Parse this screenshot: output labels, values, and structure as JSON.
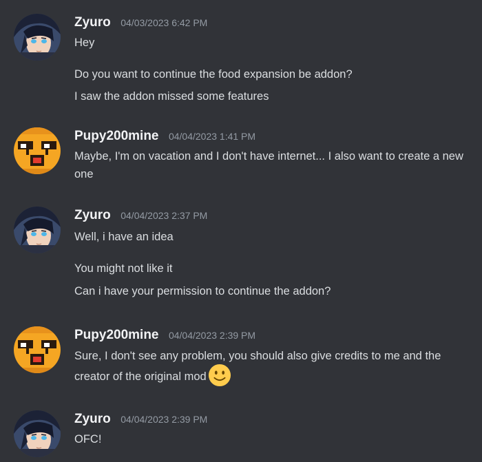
{
  "messages": [
    {
      "username": "Zyuro",
      "avatar": "anime-character-avatar",
      "timestamp": "04/03/2023 6:42 PM",
      "lines": [
        "Hey",
        "Do you want to continue the food expansion be addon?",
        "I saw the addon missed some features"
      ]
    },
    {
      "username": "Pupy200mine",
      "avatar": "pixel-creeper-face-avatar",
      "timestamp": "04/04/2023 1:41 PM",
      "lines": [
        "Maybe, I'm on vacation and I don't have internet... I also want to create a new one"
      ]
    },
    {
      "username": "Zyuro",
      "avatar": "anime-character-avatar",
      "timestamp": "04/04/2023 2:37 PM",
      "lines": [
        "Well, i have an idea",
        "You might not like it",
        "Can i have your permission to continue the addon?"
      ]
    },
    {
      "username": "Pupy200mine",
      "avatar": "pixel-creeper-face-avatar",
      "timestamp": "04/04/2023 2:39 PM",
      "lines": [
        "Sure, I don't see any problem, you should also give credits to me and the creator of the original mod"
      ],
      "emoji": "slightly-smiling-face-emoji"
    },
    {
      "username": "Zyuro",
      "avatar": "anime-character-avatar",
      "timestamp": "04/04/2023 2:39 PM",
      "lines": [
        "OFC!"
      ]
    }
  ],
  "colors": {
    "background": "#313338",
    "username": "#f2f3f5",
    "timestamp": "#949ba4",
    "message_text": "#dbdee1",
    "avatar_orange": "#f5a623"
  }
}
